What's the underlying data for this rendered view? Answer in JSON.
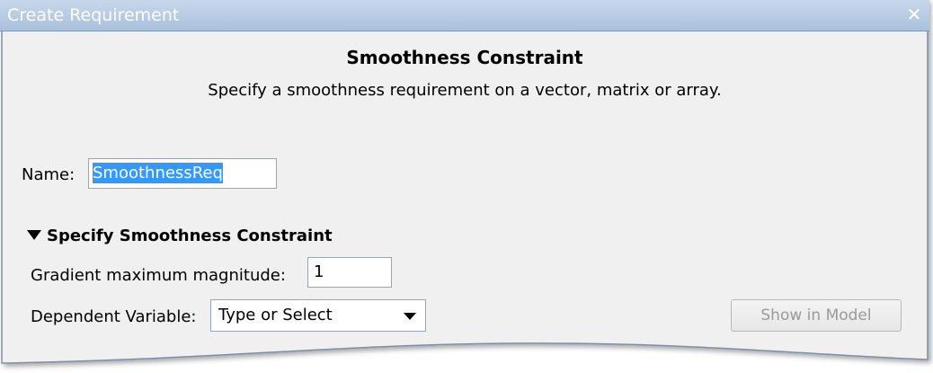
{
  "window": {
    "title": "Create Requirement",
    "close_glyph": "✕"
  },
  "header": {
    "title": "Smoothness Constraint",
    "description": "Specify a smoothness requirement on a vector, matrix or array."
  },
  "name_field": {
    "label": "Name:",
    "value": "SmoothnessReq"
  },
  "section": {
    "title": "Specify Smoothness Constraint",
    "expanded": true,
    "gradient": {
      "label": "Gradient maximum magnitude:",
      "value": "1"
    },
    "dependent_variable": {
      "label": "Dependent Variable:",
      "selected": "Type or Select"
    },
    "show_in_model_button": "Show in Model"
  },
  "colors": {
    "titlebar": "#b8cce4",
    "panel": "#f0f0f0",
    "selection": "#3399ff"
  }
}
